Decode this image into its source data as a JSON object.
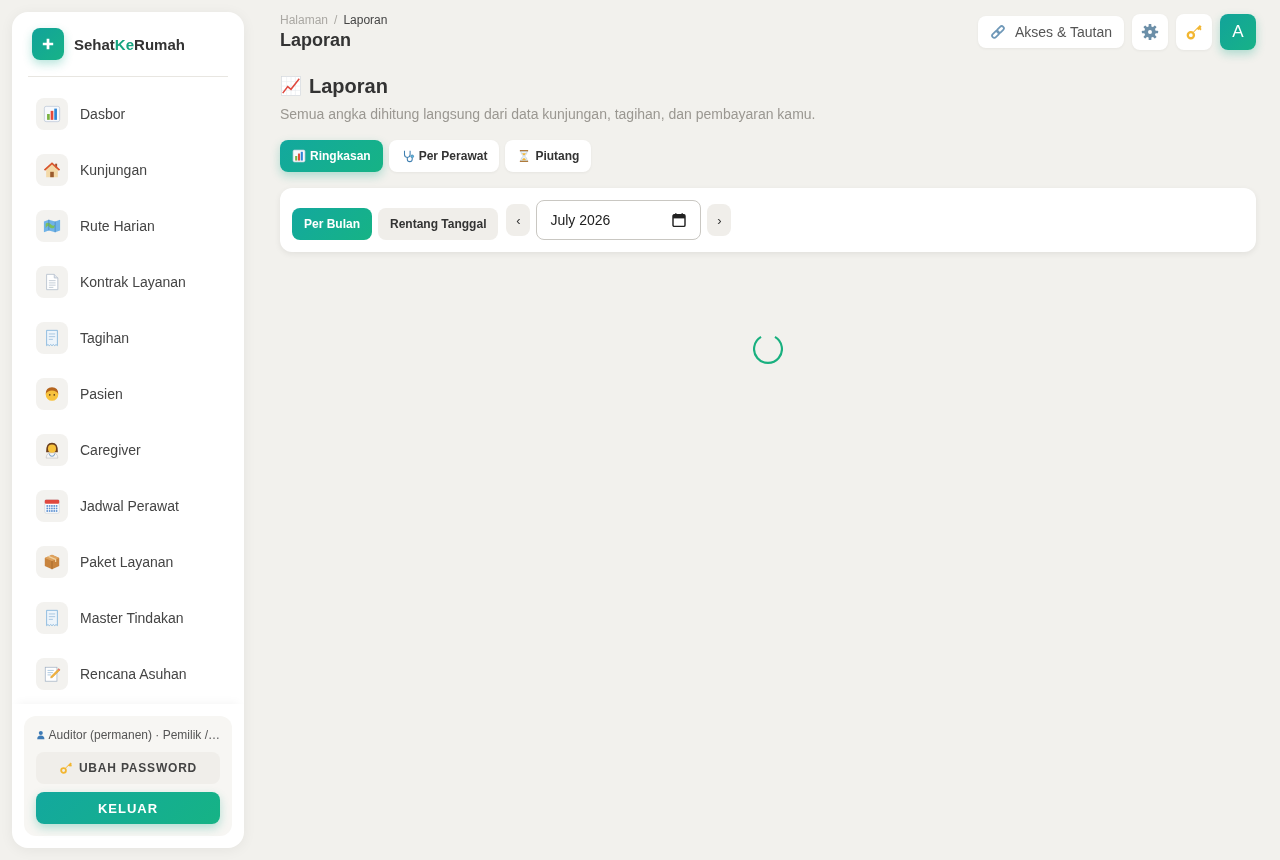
{
  "sidebar": {
    "brand": {
      "name_start": "Sehat",
      "name_accent": "Ke",
      "name_end": "Rumah"
    },
    "nav_items": [
      {
        "label": "Dasbor",
        "selected": false
      },
      {
        "label": "Kunjungan",
        "selected": false
      },
      {
        "label": "Rute Harian",
        "selected": false
      },
      {
        "label": "Kontrak Layanan",
        "selected": false
      },
      {
        "label": "Tagihan",
        "selected": false
      },
      {
        "label": "Pasien",
        "selected": false
      },
      {
        "label": "Caregiver",
        "selected": false
      },
      {
        "label": "Jadwal Perawat",
        "selected": false
      },
      {
        "label": "Paket Layanan",
        "selected": false
      },
      {
        "label": "Master Tindakan",
        "selected": false
      },
      {
        "label": "Rencana Asuhan",
        "selected": false
      }
    ],
    "account": {
      "role": "Auditor (permanen) · Pemilik /…",
      "change_password_button": "UBAH PASSWORD",
      "logout_button": "KELUAR"
    }
  },
  "header": {
    "breadcrumb": {
      "items": [
        "Halaman",
        "Laporan"
      ],
      "separator": "/"
    },
    "title": "Laporan",
    "access_button": "Akses & Tautan",
    "avatar": "A"
  },
  "page": {
    "title": "Laporan",
    "subtitle": "Semua angka dihitung langsung dari data kunjungan, tagihan, dan pembayaran kamu.",
    "tabs": [
      {
        "label": "Ringkasan",
        "selected": true
      },
      {
        "label": "Per Perawat",
        "selected": false
      },
      {
        "label": "Piutang",
        "selected": false
      }
    ],
    "filter": {
      "modes": [
        {
          "label": "Per Bulan",
          "selected": true
        },
        {
          "label": "Rentang Tanggal",
          "selected": false
        }
      ],
      "prev_button": "‹",
      "month": "July 2026",
      "next_button": "›"
    },
    "loading": true
  }
}
